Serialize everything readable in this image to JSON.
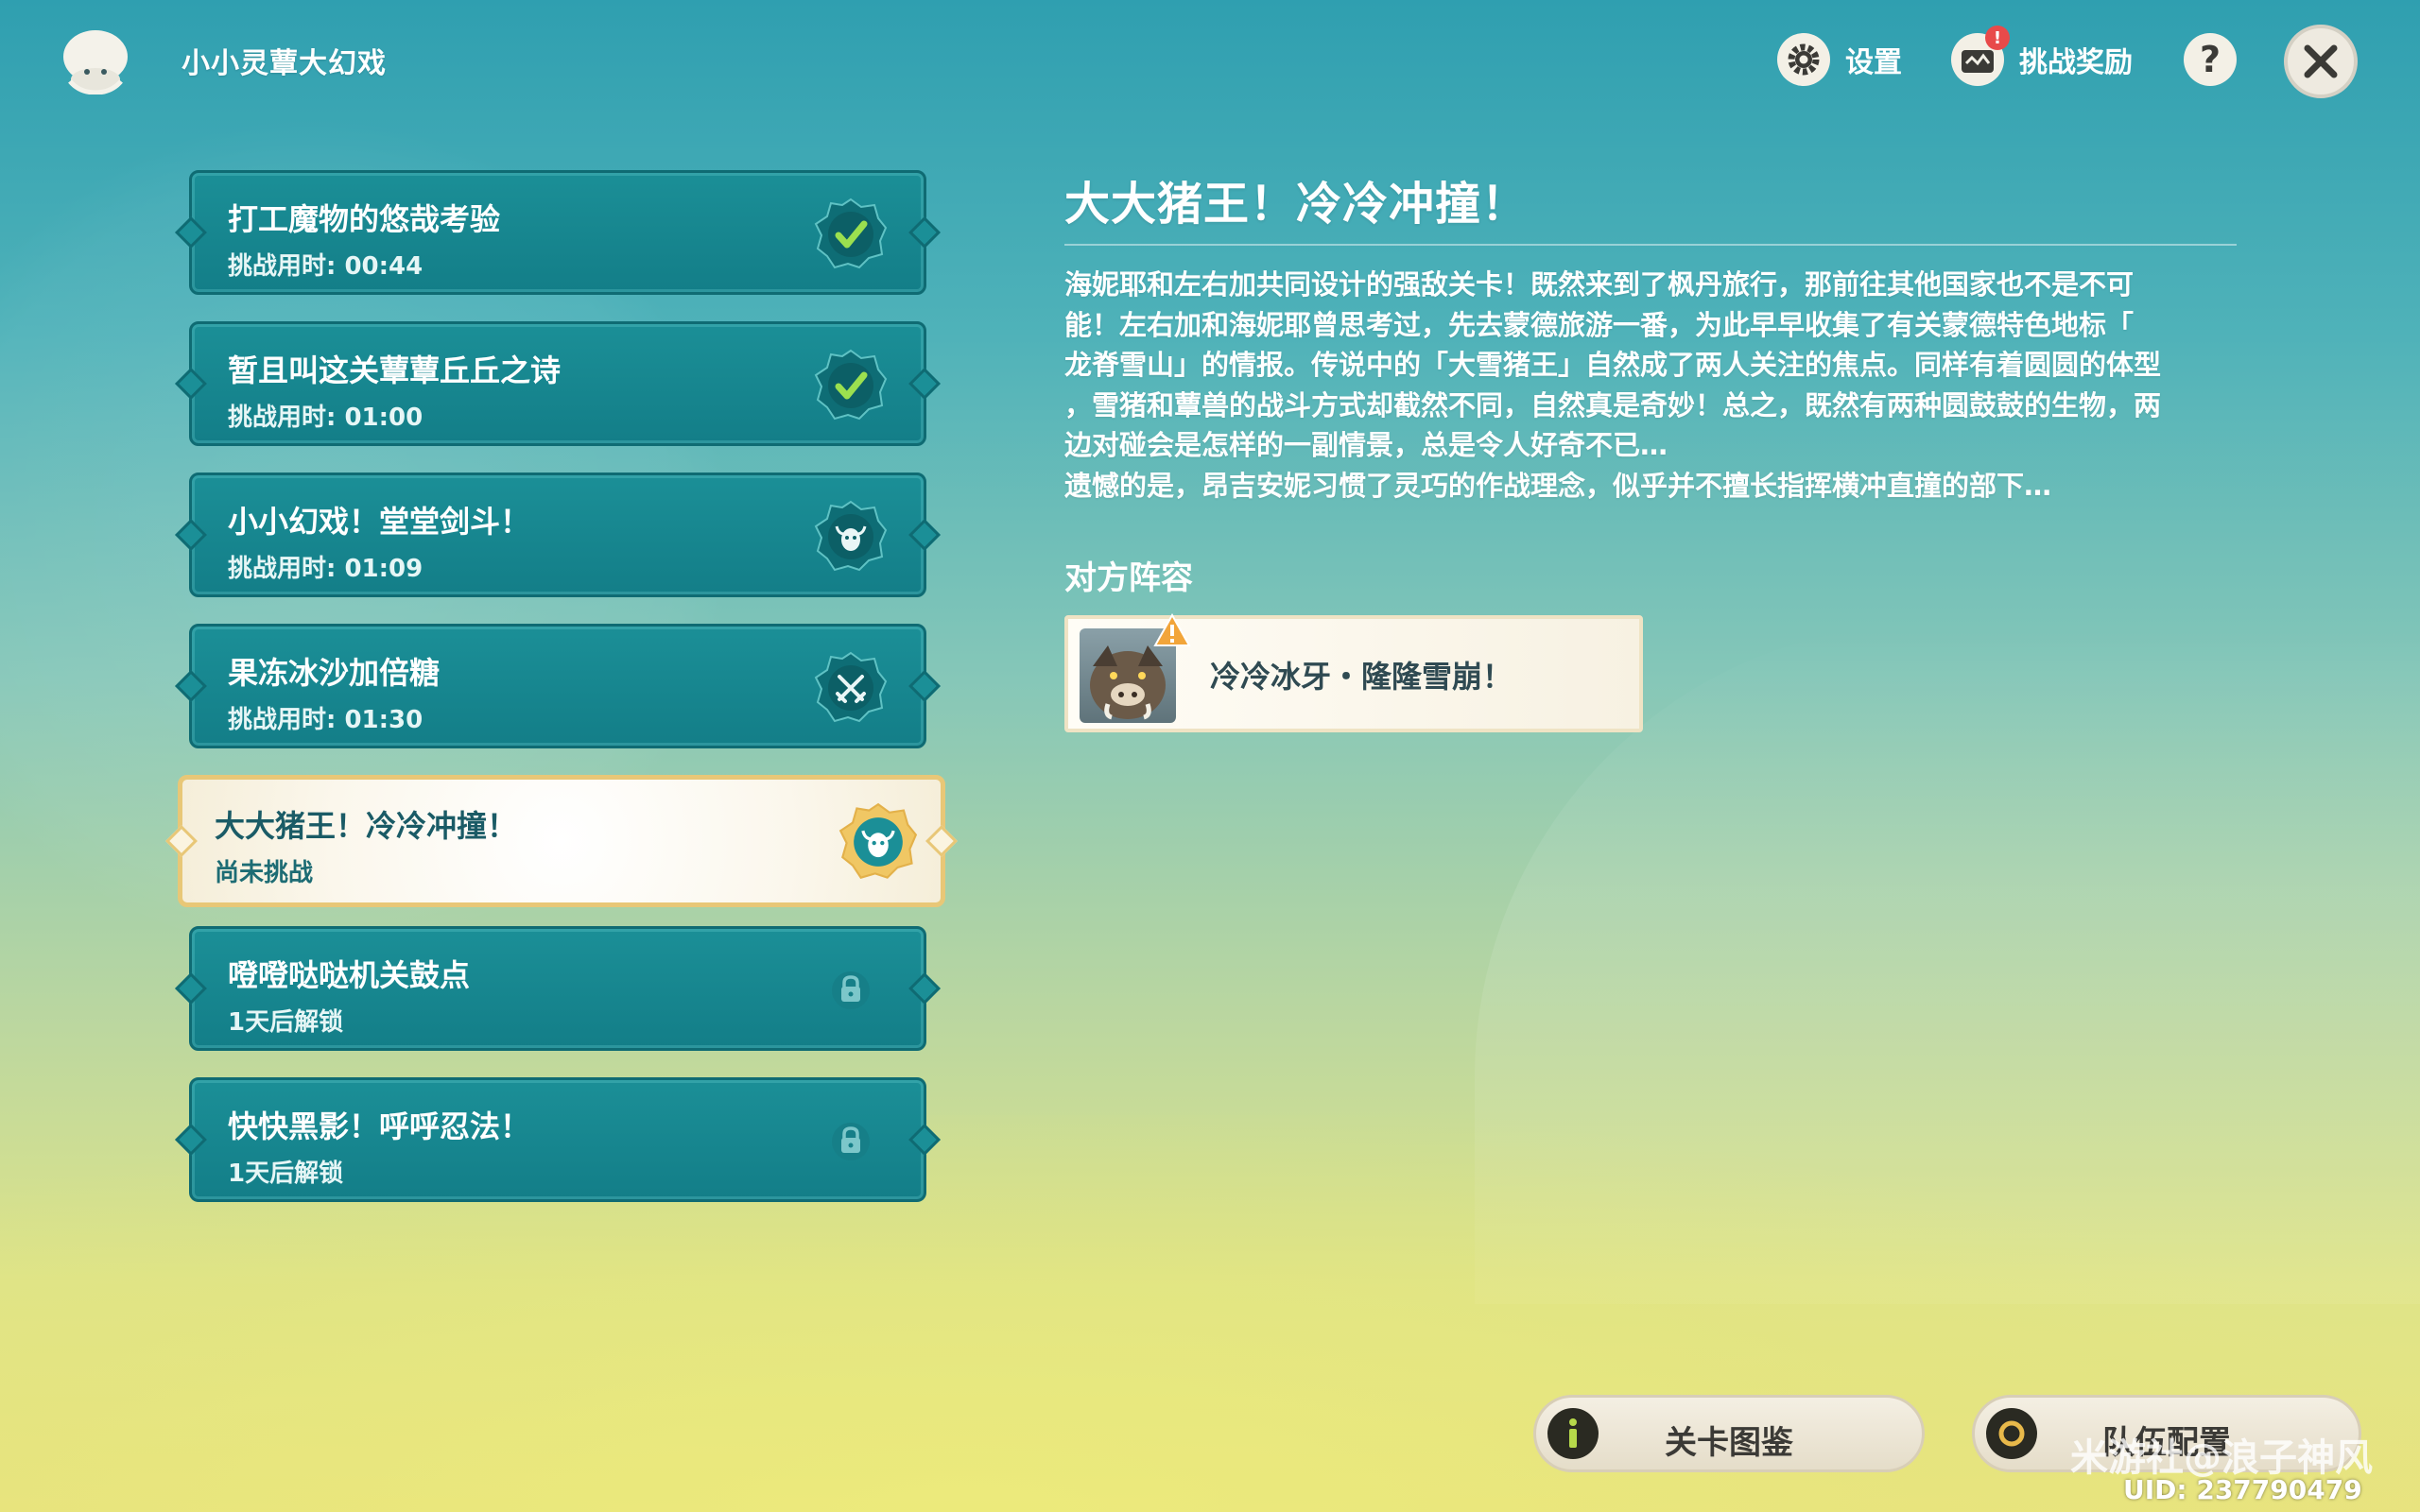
{
  "header": {
    "app_title": "小小灵蕈大幻戏",
    "settings_label": "设置",
    "rewards_label": "挑战奖励",
    "rewards_badge": "!",
    "help_label": "?"
  },
  "levels": [
    {
      "name": "打工魔物的悠哉考验",
      "status": "挑战用时: 00:44",
      "icon": "checkmark-icon"
    },
    {
      "name": "暂且叫这关蕈蕈丘丘之诗",
      "status": "挑战用时: 01:00",
      "icon": "checkmark-icon"
    },
    {
      "name": "小小幻戏！堂堂剑斗！",
      "status": "挑战用时: 01:09",
      "icon": "bull-skull-icon"
    },
    {
      "name": "果冻冰沙加倍糖",
      "status": "挑战用时: 01:30",
      "icon": "crossed-swords-icon"
    },
    {
      "name": "大大猪王！冷冷冲撞！",
      "status": "尚未挑战",
      "icon": "bull-skull-icon"
    },
    {
      "name": "噔噔哒哒机关鼓点",
      "status": "1天后解锁",
      "icon": "lock-icon"
    },
    {
      "name": "快快黑影！呼呼忍法！",
      "status": "1天后解锁",
      "icon": "lock-icon"
    }
  ],
  "detail": {
    "title": "大大猪王！冷冷冲撞！",
    "description_lines": [
      "海妮耶和左右加共同设计的强敌关卡！既然来到了枫丹旅行，那前往其他国家也不是不可",
      "能！左右加和海妮耶曾思考过，先去蒙德旅游一番，为此早早收集了有关蒙德特色地标「",
      "龙脊雪山」的情报。传说中的「大雪猪王」自然成了两人关注的焦点。同样有着圆圆的体型",
      "，雪猪和蕈兽的战斗方式却截然不同，自然真是奇妙！总之，既然有两种圆鼓鼓的生物，两",
      "边对碰会是怎样的一副情景，总是令人好奇不已…",
      "遗憾的是，昂吉安妮习惯了灵巧的作战理念，似乎并不擅长指挥横冲直撞的部下…"
    ],
    "enemy_heading": "对方阵容",
    "enemy_name": "冷冷冰牙・隆隆雪崩！"
  },
  "bottom": {
    "guide_label": "关卡图鉴",
    "team_label": "队伍配置"
  },
  "watermark": "米游社@浪子神风",
  "uid": "UID: 237790479",
  "colors": {
    "panel_teal": "#1b8f97",
    "active_border": "#e8c777",
    "accent_green": "#8fd14f"
  }
}
